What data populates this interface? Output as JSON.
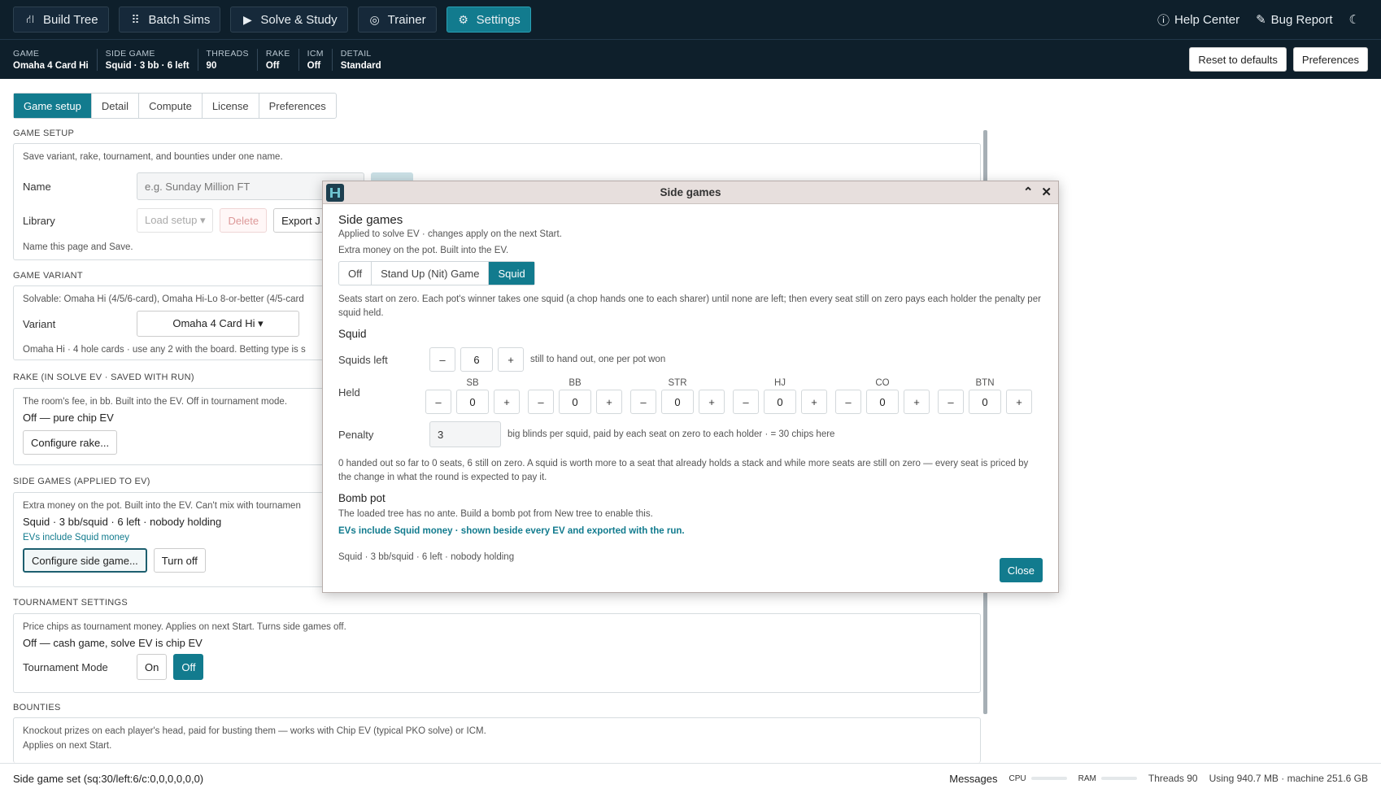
{
  "nav": {
    "items": [
      {
        "label": "Build Tree",
        "icon": "tree-icon"
      },
      {
        "label": "Batch Sims",
        "icon": "grid-icon"
      },
      {
        "label": "Solve & Study",
        "icon": "play-icon"
      },
      {
        "label": "Trainer",
        "icon": "target-icon"
      },
      {
        "label": "Settings",
        "icon": "gear-icon",
        "active": true
      }
    ],
    "help": "Help Center",
    "bug": "Bug Report",
    "theme_icon": "moon-icon"
  },
  "status": {
    "items": [
      {
        "k": "GAME",
        "v": "Omaha 4 Card Hi"
      },
      {
        "k": "SIDE GAME",
        "v": "Squid · 3 bb · 6 left"
      },
      {
        "k": "THREADS",
        "v": "90"
      },
      {
        "k": "RAKE",
        "v": "Off"
      },
      {
        "k": "ICM",
        "v": "Off"
      },
      {
        "k": "DETAIL",
        "v": "Standard"
      }
    ],
    "reset": "Reset to defaults",
    "prefs": "Preferences"
  },
  "tabs": [
    "Game setup",
    "Detail",
    "Compute",
    "License",
    "Preferences"
  ],
  "game_setup": {
    "title": "GAME SETUP",
    "desc": "Save variant, rake, tournament, and bounties under one name.",
    "name_label": "Name",
    "name_placeholder": "e.g. Sunday Million FT",
    "library_label": "Library",
    "load": "Load setup ▾",
    "delete": "Delete",
    "export": "Export J",
    "hint": "Name this page and Save."
  },
  "variant": {
    "title": "GAME VARIANT",
    "desc": "Solvable: Omaha Hi (4/5/6-card), Omaha Hi-Lo 8-or-better (4/5-card",
    "label": "Variant",
    "value": "Omaha 4 Card Hi ▾",
    "hint": "Omaha Hi · 4 hole cards · use any 2 with the board. Betting type is s"
  },
  "rake": {
    "title": "RAKE (IN SOLVE EV · SAVED WITH RUN)",
    "desc": "The room's fee, in bb. Built into the EV. Off in tournament mode.",
    "state": "Off — pure chip EV",
    "button": "Configure rake..."
  },
  "side": {
    "title": "SIDE GAMES (APPLIED TO EV)",
    "desc": "Extra money on the pot. Built into the EV. Can't mix with tournamen",
    "state": "Squid · 3 bb/squid · 6 left · nobody holding",
    "ev": "EVs include Squid money",
    "configure": "Configure side game...",
    "off": "Turn off"
  },
  "tournament": {
    "title": "TOURNAMENT SETTINGS",
    "desc": "Price chips as tournament money. Applies on next Start. Turns side games off.",
    "state": "Off — cash game, solve EV is chip EV",
    "label": "Tournament Mode",
    "on": "On",
    "off": "Off"
  },
  "bounties": {
    "title": "BOUNTIES",
    "desc1": "Knockout prizes on each player's head, paid for busting them — works with Chip EV (typical PKO solve) or ICM.",
    "desc2": "Applies on next Start."
  },
  "dialog": {
    "title": "Side games",
    "heading": "Side games",
    "sub1": "Applied to solve EV · changes apply on the next Start.",
    "sub2": "Extra money on the pot. Built into the EV.",
    "modes": [
      "Off",
      "Stand Up (Nit) Game",
      "Squid"
    ],
    "rules": "Seats start on zero. Each pot's winner takes one squid (a chop hands one to each sharer) until none are left; then every seat still on zero pays each holder the penalty per squid held.",
    "squid_h": "Squid",
    "left_label": "Squids left",
    "left_value": "6",
    "left_hint": "still to hand out, one per pot won",
    "held_label": "Held",
    "seats": [
      {
        "n": "SB",
        "v": "0"
      },
      {
        "n": "BB",
        "v": "0"
      },
      {
        "n": "STR",
        "v": "0"
      },
      {
        "n": "HJ",
        "v": "0"
      },
      {
        "n": "CO",
        "v": "0"
      },
      {
        "n": "BTN",
        "v": "0"
      }
    ],
    "penalty_label": "Penalty",
    "penalty_value": "3",
    "penalty_hint": "big blinds per squid, paid by each seat on zero to each holder · = 30 chips here",
    "note": "0 handed out so far to 0 seats, 6 still on zero. A squid is worth more to a seat that already holds a stack and while more seats are still on zero — every seat is priced by the change in what the round is expected to pay it.",
    "bomb_h": "Bomb pot",
    "bomb_desc": "The loaded tree has no ante. Build a bomb pot from New tree to enable this.",
    "ev_note": "EVs include Squid money · shown beside every EV and exported with the run.",
    "summary": "Squid · 3 bb/squid · 6 left · nobody holding",
    "close": "Close",
    "minus": "–",
    "plus": "+"
  },
  "bottom": {
    "left": "Side game set (sq:30/left:6/c:0,0,0,0,0,0)",
    "messages": "Messages",
    "cpu": "CPU",
    "ram": "RAM",
    "threads": "Threads 90",
    "using": "Using 940.7 MB · machine 251.6 GB"
  }
}
